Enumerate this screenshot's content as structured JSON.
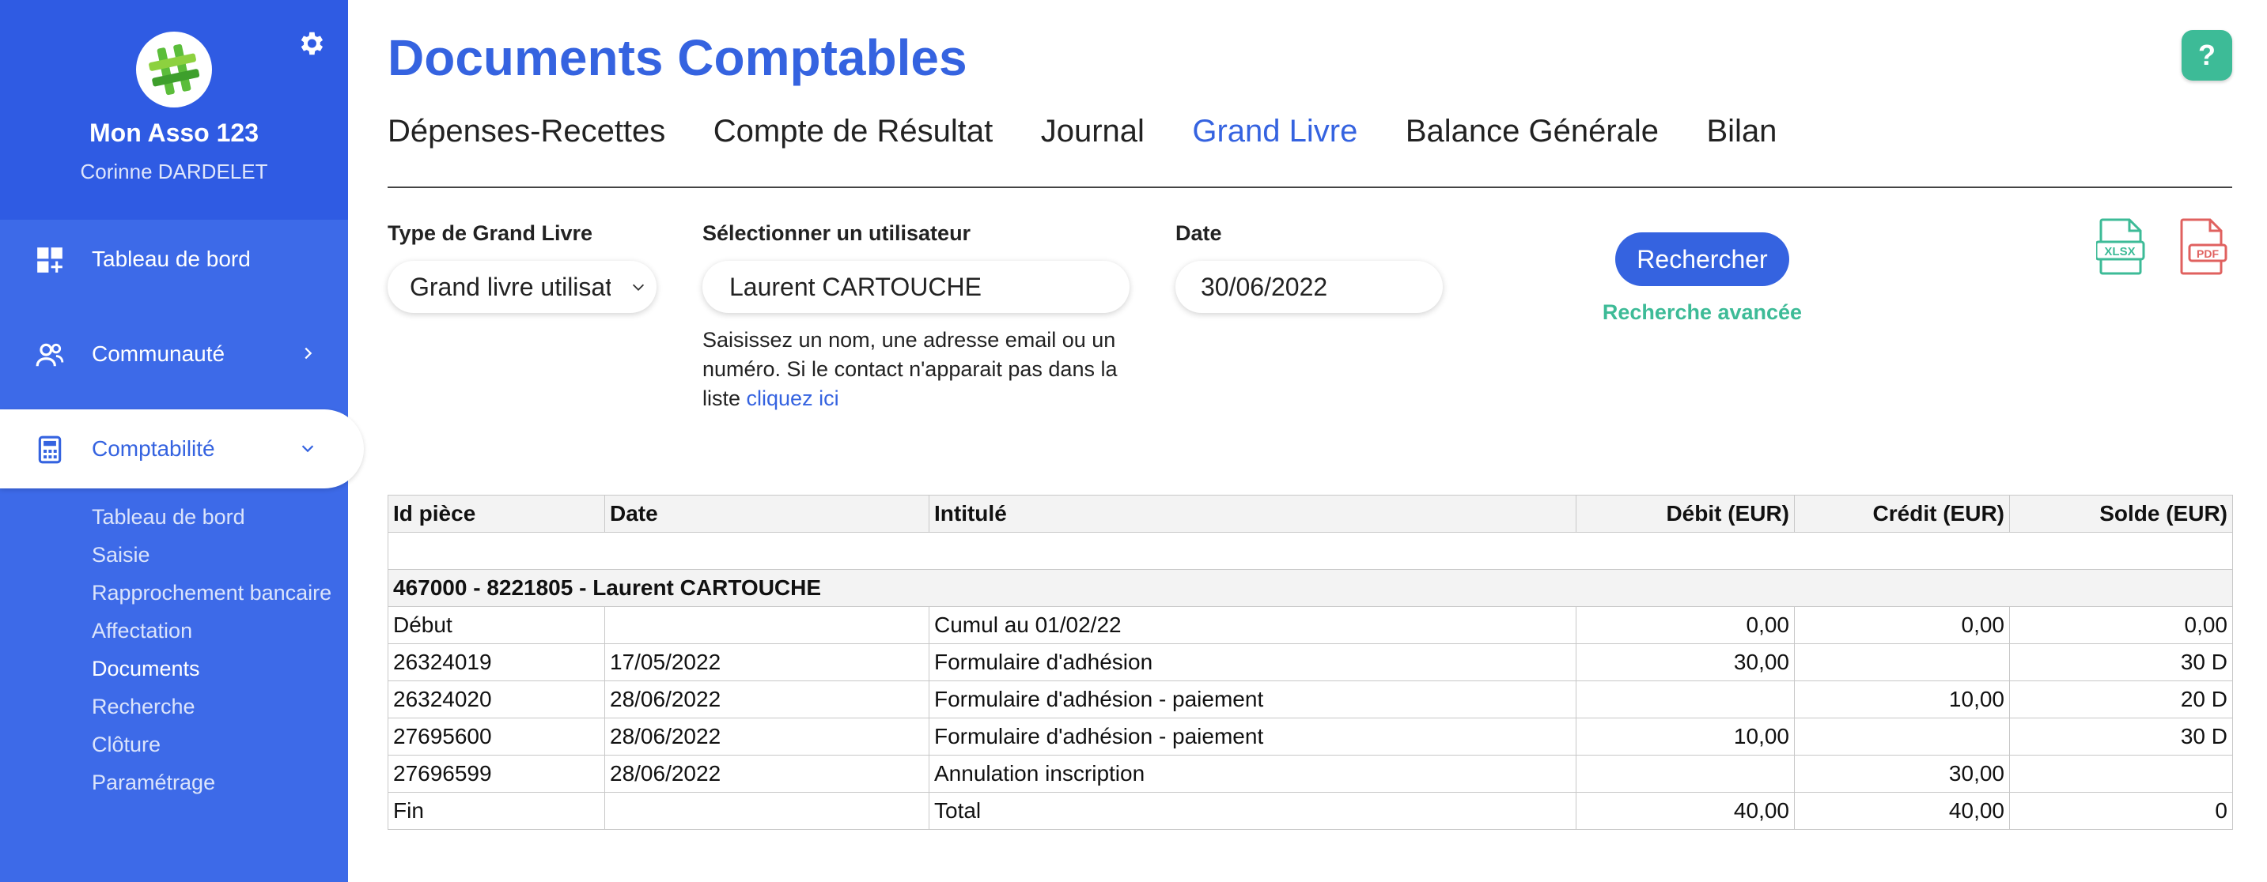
{
  "sidebar": {
    "asso_name": "Mon Asso 123",
    "user_name": "Corinne DARDELET",
    "nav": {
      "dashboard": "Tableau de bord",
      "community": "Communauté",
      "accounting": "Comptabilité"
    },
    "sub_items": [
      "Tableau de bord",
      "Saisie",
      "Rapprochement bancaire",
      "Affectation",
      "Documents",
      "Recherche",
      "Clôture",
      "Paramétrage"
    ],
    "active_sub_item": "Documents"
  },
  "page": {
    "title": "Documents Comptables",
    "help_label": "?"
  },
  "tabs": [
    "Dépenses-Recettes",
    "Compte de Résultat",
    "Journal",
    "Grand Livre",
    "Balance Générale",
    "Bilan"
  ],
  "active_tab": "Grand Livre",
  "filters": {
    "type_label": "Type de Grand Livre",
    "type_value": "Grand livre utilisateur",
    "user_label": "Sélectionner un utilisateur",
    "user_value": "Laurent CARTOUCHE",
    "date_label": "Date",
    "date_value": "30/06/2022",
    "help_text": "Saisissez un nom, une adresse email ou un numéro. Si le contact n'apparait pas dans la liste",
    "help_link": "cliquez ici",
    "search_button": "Rechercher",
    "advanced_search": "Recherche avancée"
  },
  "exports": {
    "xlsx": "XLSX",
    "pdf": "PDF"
  },
  "colors": {
    "primary": "#3563e0",
    "sidebar": "#3d6ae8",
    "accent_green": "#3dbb97",
    "pdf_red": "#e0615f"
  },
  "table": {
    "headers": [
      "Id pièce",
      "Date",
      "Intitulé",
      "Débit (EUR)",
      "Crédit (EUR)",
      "Solde (EUR)"
    ],
    "group_label": "467000 - 8221805 - Laurent CARTOUCHE",
    "rows": [
      [
        "Début",
        "",
        "Cumul au 01/02/22",
        "0,00",
        "0,00",
        "0,00"
      ],
      [
        "26324019",
        "17/05/2022",
        "Formulaire d'adhésion",
        "30,00",
        "",
        "30 D"
      ],
      [
        "26324020",
        "28/06/2022",
        "Formulaire d'adhésion - paiement",
        "",
        "10,00",
        "20 D"
      ],
      [
        "27695600",
        "28/06/2022",
        "Formulaire d'adhésion - paiement",
        "10,00",
        "",
        "30 D"
      ],
      [
        "27696599",
        "28/06/2022",
        "Annulation inscription",
        "",
        "30,00",
        ""
      ],
      [
        "Fin",
        "",
        "Total",
        "40,00",
        "40,00",
        "0"
      ]
    ]
  }
}
